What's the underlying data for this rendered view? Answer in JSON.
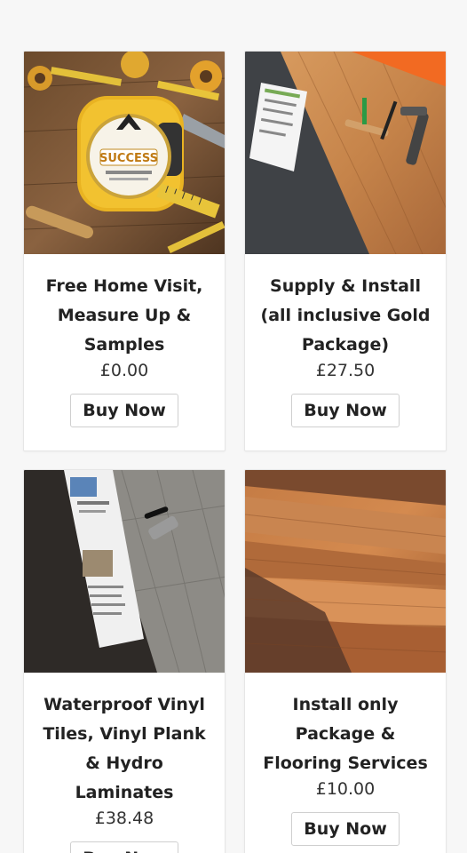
{
  "products": [
    {
      "title": "Free Home Visit, Measure Up & Samples",
      "price": "£0.00",
      "button": "Buy Now",
      "image_icon": "tape-measure-image",
      "image_badge": "SUCCESS"
    },
    {
      "title": "Supply & Install (all inclusive Gold Package)",
      "price": "£27.50",
      "button": "Buy Now",
      "image_icon": "laminate-install-image"
    },
    {
      "title": "Waterproof Vinyl Tiles, Vinyl Plank & Hydro Laminates",
      "price": "£38.48",
      "button": "Buy Now",
      "image_icon": "vinyl-plank-image"
    },
    {
      "title": "Install only Package & Flooring Services",
      "price": "£10.00",
      "button": "Buy Now",
      "image_icon": "wood-floor-image"
    }
  ],
  "colors": {
    "page_bg": "#f7f7f7",
    "card_bg": "#ffffff",
    "text": "#222222"
  }
}
